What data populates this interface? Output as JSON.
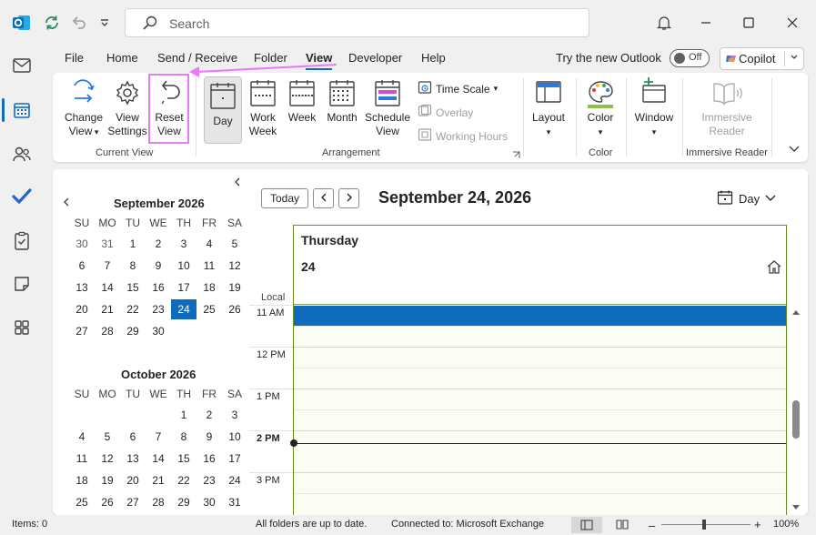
{
  "titlebar": {
    "search_placeholder": "Search"
  },
  "menu": {
    "tabs": [
      "File",
      "Home",
      "Send / Receive",
      "Folder",
      "View",
      "Developer",
      "Help"
    ],
    "active_tab": "View",
    "try_new_label": "Try the new Outlook",
    "toggle_label": "Off",
    "copilot_label": "Copilot"
  },
  "ribbon": {
    "change_view": [
      "Change",
      "View"
    ],
    "view_settings": [
      "View",
      "Settings"
    ],
    "reset_view": [
      "Reset",
      "View"
    ],
    "group_current_view": "Current View",
    "day": "Day",
    "work_week": [
      "Work",
      "Week"
    ],
    "week": "Week",
    "month": "Month",
    "schedule_view": [
      "Schedule",
      "View"
    ],
    "time_scale": "Time Scale",
    "overlay": "Overlay",
    "working_hours": "Working Hours",
    "group_arrangement": "Arrangement",
    "layout": "Layout",
    "color": "Color",
    "group_color": "Color",
    "window": "Window",
    "immersive_reader": [
      "Immersive",
      "Reader"
    ],
    "group_immersive_reader": "Immersive Reader"
  },
  "minical": {
    "months": [
      {
        "title": "September 2026",
        "dow": [
          "SU",
          "MO",
          "TU",
          "WE",
          "TH",
          "FR",
          "SA"
        ],
        "weeks": [
          [
            "30",
            "31",
            "1",
            "2",
            "3",
            "4",
            "5"
          ],
          [
            "6",
            "7",
            "8",
            "9",
            "10",
            "11",
            "12"
          ],
          [
            "13",
            "14",
            "15",
            "16",
            "17",
            "18",
            "19"
          ],
          [
            "20",
            "21",
            "22",
            "23",
            "24",
            "25",
            "26"
          ],
          [
            "27",
            "28",
            "29",
            "30",
            "",
            "",
            ""
          ]
        ],
        "other_month": [
          "30",
          "31"
        ],
        "today": "24"
      },
      {
        "title": "October 2026",
        "dow": [
          "SU",
          "MO",
          "TU",
          "WE",
          "TH",
          "FR",
          "SA"
        ],
        "weeks": [
          [
            "",
            "",
            "",
            "",
            "1",
            "2",
            "3"
          ],
          [
            "4",
            "5",
            "6",
            "7",
            "8",
            "9",
            "10"
          ],
          [
            "11",
            "12",
            "13",
            "14",
            "15",
            "16",
            "17"
          ],
          [
            "18",
            "19",
            "20",
            "21",
            "22",
            "23",
            "24"
          ],
          [
            "25",
            "26",
            "27",
            "28",
            "29",
            "30",
            "31"
          ]
        ]
      }
    ]
  },
  "calendar": {
    "today_button": "Today",
    "title": "September 24, 2026",
    "view_label": "Day",
    "day_name": "Thursday",
    "day_number": "24",
    "local_label": "Local",
    "time_slots": [
      "11 AM",
      "12 PM",
      "1 PM",
      "2 PM",
      "3 PM"
    ],
    "current_hour": "2 PM"
  },
  "status": {
    "items": "Items: 0",
    "folders": "All folders are up to date.",
    "connection": "Connected to: Microsoft Exchange",
    "zoom": "100%"
  },
  "colors": {
    "accent": "#0f6cbd",
    "highlight": "#e879f9",
    "day_border": "#6b8e23"
  }
}
